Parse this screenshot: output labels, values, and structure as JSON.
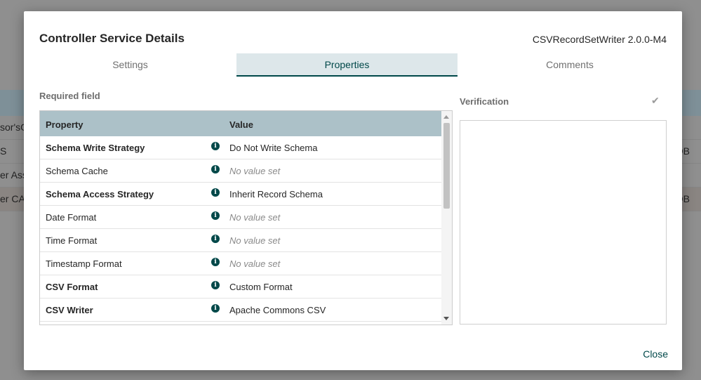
{
  "background": {
    "rows": [
      {
        "left": "sor'sOt",
        "right": ""
      },
      {
        "left": "S",
        "right": "OB"
      },
      {
        "left": "er Ass",
        "right": ""
      },
      {
        "left": "er CA",
        "right": "OB"
      }
    ]
  },
  "modal": {
    "title": "Controller Service Details",
    "subtitle": "CSVRecordSetWriter 2.0.0-M4",
    "tabs": [
      {
        "label": "Settings",
        "active": false
      },
      {
        "label": "Properties",
        "active": true
      },
      {
        "label": "Comments",
        "active": false
      }
    ],
    "required_field_label": "Required field",
    "table": {
      "headers": [
        "Property",
        "Value"
      ],
      "rows": [
        {
          "name": "Schema Write Strategy",
          "required": true,
          "value": "Do Not Write Schema",
          "empty": false
        },
        {
          "name": "Schema Cache",
          "required": false,
          "value": "No value set",
          "empty": true
        },
        {
          "name": "Schema Access Strategy",
          "required": true,
          "value": "Inherit Record Schema",
          "empty": false
        },
        {
          "name": "Date Format",
          "required": false,
          "value": "No value set",
          "empty": true
        },
        {
          "name": "Time Format",
          "required": false,
          "value": "No value set",
          "empty": true
        },
        {
          "name": "Timestamp Format",
          "required": false,
          "value": "No value set",
          "empty": true
        },
        {
          "name": "CSV Format",
          "required": true,
          "value": "Custom Format",
          "empty": false
        },
        {
          "name": "CSV Writer",
          "required": true,
          "value": "Apache Commons CSV",
          "empty": false
        }
      ],
      "info_icon": "info-circle-icon"
    },
    "verification": {
      "label": "Verification",
      "icon": "checkmark-icon"
    },
    "close_label": "Close"
  },
  "colors": {
    "accent": "#004849",
    "active_tab_bg": "#dde7ea",
    "table_header_bg": "#acc1c8"
  }
}
